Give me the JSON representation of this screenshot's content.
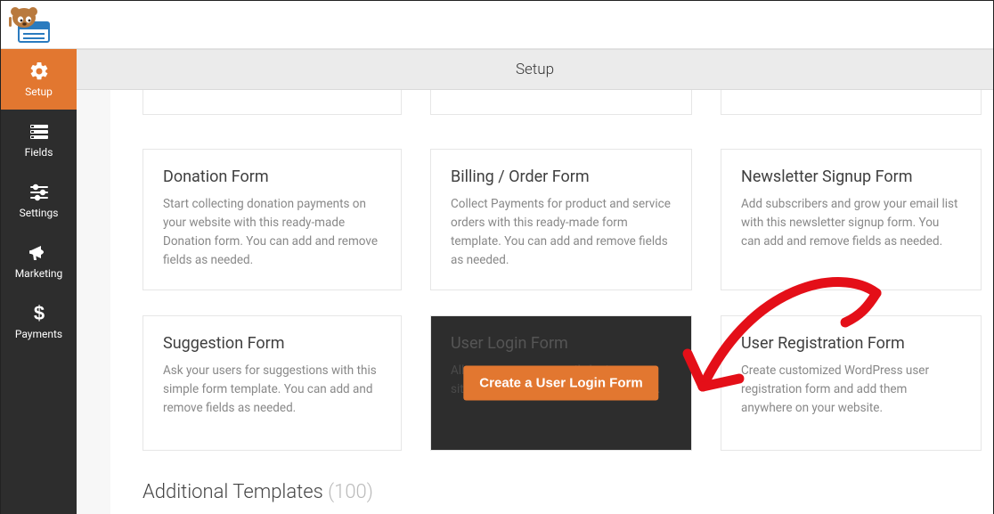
{
  "page_title": "Setup",
  "sidebar": {
    "items": [
      {
        "label": "Setup"
      },
      {
        "label": "Fields"
      },
      {
        "label": "Settings"
      },
      {
        "label": "Marketing"
      },
      {
        "label": "Payments"
      }
    ]
  },
  "row1": {
    "card1": {
      "title": "Donation Form",
      "desc": "Start collecting donation payments on your website with this ready-made Donation form. You can add and remove fields as needed."
    },
    "card2": {
      "title": "Billing / Order Form",
      "desc": "Collect Payments for product and service orders with this ready-made form template. You can add and remove fields as needed."
    },
    "card3": {
      "title": "Newsletter Signup Form",
      "desc": "Add subscribers and grow your email list with this newsletter signup form. You can add and remove fields as needed."
    }
  },
  "row2": {
    "card1": {
      "title": "Suggestion Form",
      "desc": "Ask your users for suggestions with this simple form template. You can add and remove fields as needed."
    },
    "card2": {
      "title": "User Login Form",
      "desc": "Allow your users to easily login to your site with their username and password.",
      "button": "Create a User Login Form"
    },
    "card3": {
      "title": "User Registration Form",
      "desc": "Create customized WordPress user registration form and add them anywhere on your website."
    }
  },
  "additional": {
    "label": "Additional Templates ",
    "count": "(100)"
  }
}
